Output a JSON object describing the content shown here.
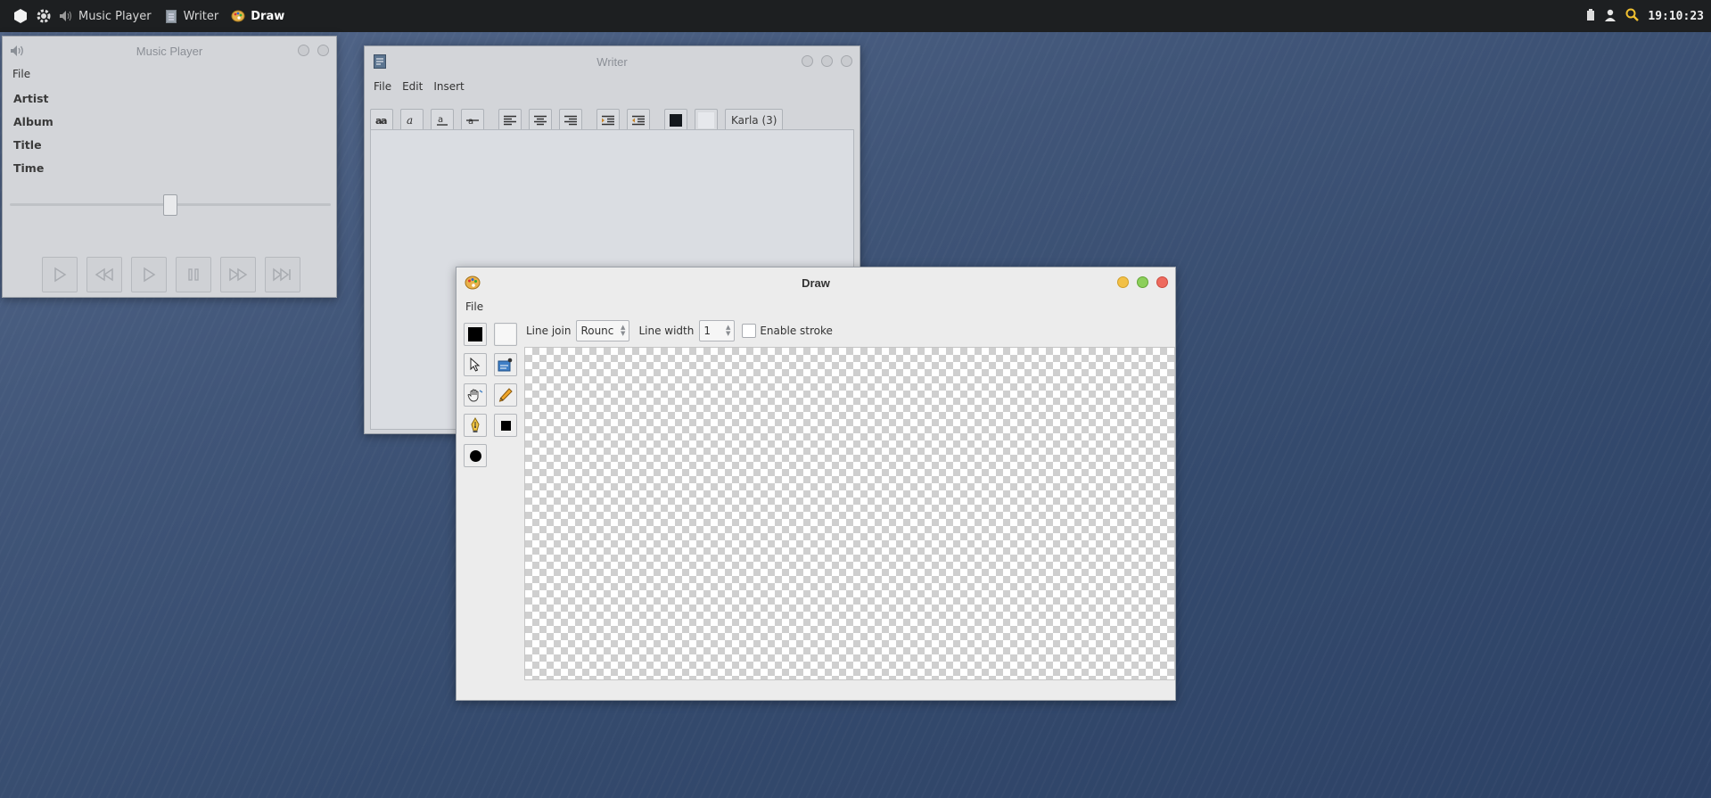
{
  "panel": {
    "apps": [
      {
        "label": "Music Player",
        "icon": "speaker-icon"
      },
      {
        "label": "Writer",
        "icon": "document-icon"
      },
      {
        "label": "Draw",
        "icon": "palette-icon"
      }
    ],
    "clock": "19:10:23"
  },
  "music_player": {
    "title": "Music Player",
    "menu": [
      "File"
    ],
    "fields": [
      "Artist",
      "Album",
      "Title",
      "Time"
    ],
    "seek_position": 0.5,
    "controls": [
      "play-icon",
      "rewind-icon",
      "play-icon",
      "pause-icon",
      "fast-forward-icon",
      "skip-end-icon"
    ]
  },
  "writer": {
    "title": "Writer",
    "menu": [
      "File",
      "Edit",
      "Insert"
    ],
    "font_button": "Karla (3)"
  },
  "draw": {
    "title": "Draw",
    "menu": [
      "File"
    ],
    "line_join_label": "Line join",
    "line_join_value": "Rounc",
    "line_width_label": "Line width",
    "line_width_value": "1",
    "enable_stroke_label": "Enable stroke",
    "enable_stroke_checked": false
  }
}
